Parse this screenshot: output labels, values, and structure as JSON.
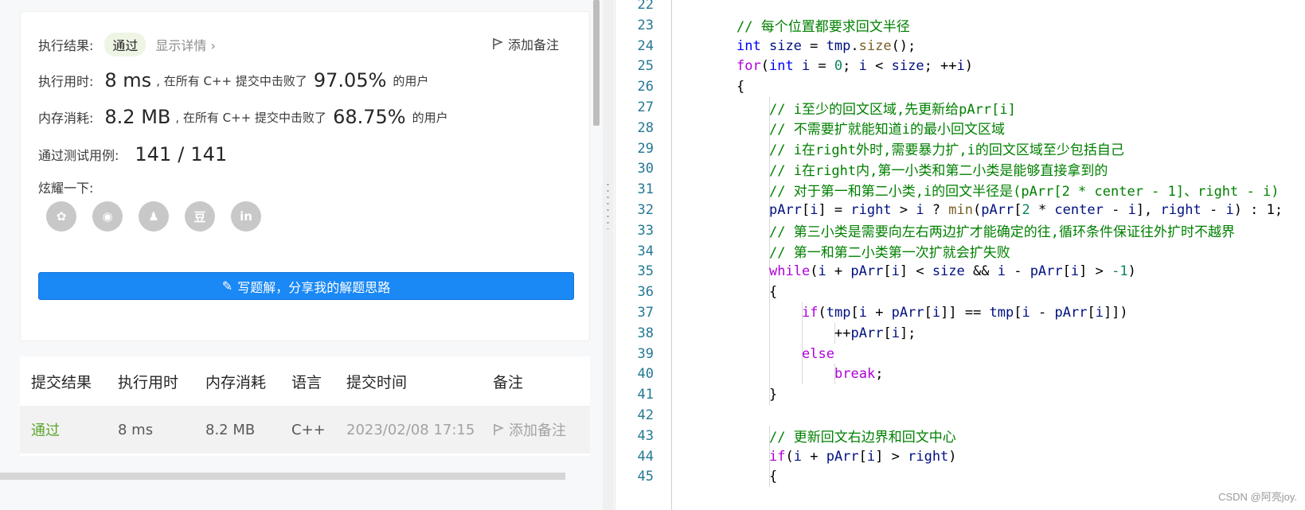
{
  "result": {
    "label": "执行结果:",
    "status": "通过",
    "details_link": "显示详情 ›",
    "add_note": "添加备注"
  },
  "runtime": {
    "label": "执行用时:",
    "value": "8 ms",
    "mid_text": ", 在所有 C++ 提交中击败了",
    "percent": "97.05%",
    "suffix": "的用户"
  },
  "memory": {
    "label": "内存消耗:",
    "value": "8.2 MB",
    "mid_text": ", 在所有 C++ 提交中击败了",
    "percent": "68.75%",
    "suffix": "的用户"
  },
  "testcases": {
    "label": "通过测试用例:",
    "passed": "141",
    "sep": "/",
    "total": "141"
  },
  "share": {
    "label": "炫耀一下:",
    "icons": [
      "wechat-icon",
      "weibo-icon",
      "qq-icon",
      "douban-icon",
      "linkedin-icon"
    ],
    "glyphs": [
      "✿",
      "◉",
      "♟",
      "豆",
      "in"
    ]
  },
  "write_button": "写题解，分享我的解题思路",
  "submissions": {
    "headers": [
      "提交结果",
      "执行用时",
      "内存消耗",
      "语言",
      "提交时间",
      "备注"
    ],
    "rows": [
      {
        "result": "通过",
        "runtime": "8 ms",
        "memory": "8.2 MB",
        "lang": "C++",
        "time": "2023/02/08 17:15",
        "note": "添加备注"
      }
    ]
  },
  "code": {
    "lines": [
      {
        "n": "22",
        "indent": 0,
        "tokens": []
      },
      {
        "n": "23",
        "indent": 1,
        "tokens": [
          [
            "cm",
            "// 每个位置都要求回文半径"
          ]
        ]
      },
      {
        "n": "24",
        "indent": 1,
        "tokens": [
          [
            "ty",
            "int"
          ],
          [
            "op",
            " "
          ],
          [
            "id",
            "size"
          ],
          [
            "op",
            " = "
          ],
          [
            "id",
            "tmp"
          ],
          [
            "op",
            "."
          ],
          [
            "fn",
            "size"
          ],
          [
            "op",
            "();"
          ]
        ]
      },
      {
        "n": "25",
        "indent": 1,
        "tokens": [
          [
            "kw",
            "for"
          ],
          [
            "op",
            "("
          ],
          [
            "ty",
            "int"
          ],
          [
            "op",
            " "
          ],
          [
            "id",
            "i"
          ],
          [
            "op",
            " = "
          ],
          [
            "num",
            "0"
          ],
          [
            "op",
            "; "
          ],
          [
            "id",
            "i"
          ],
          [
            "op",
            " < "
          ],
          [
            "id",
            "size"
          ],
          [
            "op",
            "; ++"
          ],
          [
            "id",
            "i"
          ],
          [
            "op",
            ")"
          ]
        ]
      },
      {
        "n": "26",
        "indent": 1,
        "tokens": [
          [
            "op",
            "{"
          ]
        ]
      },
      {
        "n": "27",
        "indent": 2,
        "tokens": [
          [
            "cm",
            "// i至少的回文区域,先更新给pArr[i]"
          ]
        ]
      },
      {
        "n": "28",
        "indent": 2,
        "tokens": [
          [
            "cm",
            "// 不需要扩就能知道i的最小回文区域"
          ]
        ]
      },
      {
        "n": "29",
        "indent": 2,
        "tokens": [
          [
            "cm",
            "// i在right外时,需要暴力扩,i的回文区域至少包括自己"
          ]
        ]
      },
      {
        "n": "30",
        "indent": 2,
        "tokens": [
          [
            "cm",
            "// i在right内,第一小类和第二小类是能够直接拿到的"
          ]
        ]
      },
      {
        "n": "31",
        "indent": 2,
        "tokens": [
          [
            "cm",
            "// 对于第一和第二小类,i的回文半径是(pArr[2 * center - 1]、right - i)"
          ]
        ]
      },
      {
        "n": "32",
        "indent": 2,
        "tokens": [
          [
            "id",
            "pArr"
          ],
          [
            "op",
            "["
          ],
          [
            "id",
            "i"
          ],
          [
            "op",
            "] = "
          ],
          [
            "id",
            "right"
          ],
          [
            "op",
            " > "
          ],
          [
            "id",
            "i"
          ],
          [
            "op",
            " ? "
          ],
          [
            "fn",
            "min"
          ],
          [
            "op",
            "("
          ],
          [
            "id",
            "pArr"
          ],
          [
            "op",
            "["
          ],
          [
            "num",
            "2"
          ],
          [
            "op",
            " * "
          ],
          [
            "id",
            "center"
          ],
          [
            "op",
            " - "
          ],
          [
            "id",
            "i"
          ],
          [
            "op",
            "], "
          ],
          [
            "id",
            "right"
          ],
          [
            "op",
            " - "
          ],
          [
            "id",
            "i"
          ],
          [
            "op",
            ") : 1;"
          ]
        ]
      },
      {
        "n": "33",
        "indent": 2,
        "tokens": [
          [
            "cm",
            "// 第三小类是需要向左右两边扩才能确定的往,循环条件保证往外扩时不越界"
          ]
        ]
      },
      {
        "n": "34",
        "indent": 2,
        "tokens": [
          [
            "cm",
            "// 第一和第二小类第一次扩就会扩失败"
          ]
        ]
      },
      {
        "n": "35",
        "indent": 2,
        "tokens": [
          [
            "kw",
            "while"
          ],
          [
            "op",
            "("
          ],
          [
            "id",
            "i"
          ],
          [
            "op",
            " + "
          ],
          [
            "id",
            "pArr"
          ],
          [
            "op",
            "["
          ],
          [
            "id",
            "i"
          ],
          [
            "op",
            "] < "
          ],
          [
            "id",
            "size"
          ],
          [
            "op",
            " && "
          ],
          [
            "id",
            "i"
          ],
          [
            "op",
            " - "
          ],
          [
            "id",
            "pArr"
          ],
          [
            "op",
            "["
          ],
          [
            "id",
            "i"
          ],
          [
            "op",
            "] > "
          ],
          [
            "num",
            "-1"
          ],
          [
            "op",
            ")"
          ]
        ]
      },
      {
        "n": "36",
        "indent": 2,
        "tokens": [
          [
            "op",
            "{"
          ]
        ]
      },
      {
        "n": "37",
        "indent": 3,
        "tokens": [
          [
            "kw",
            "if"
          ],
          [
            "op",
            "("
          ],
          [
            "id",
            "tmp"
          ],
          [
            "op",
            "["
          ],
          [
            "id",
            "i"
          ],
          [
            "op",
            " + "
          ],
          [
            "id",
            "pArr"
          ],
          [
            "op",
            "["
          ],
          [
            "id",
            "i"
          ],
          [
            "op",
            "]] == "
          ],
          [
            "id",
            "tmp"
          ],
          [
            "op",
            "["
          ],
          [
            "id",
            "i"
          ],
          [
            "op",
            " - "
          ],
          [
            "id",
            "pArr"
          ],
          [
            "op",
            "["
          ],
          [
            "id",
            "i"
          ],
          [
            "op",
            "]])"
          ]
        ]
      },
      {
        "n": "38",
        "indent": 4,
        "tokens": [
          [
            "op",
            "++"
          ],
          [
            "id",
            "pArr"
          ],
          [
            "op",
            "["
          ],
          [
            "id",
            "i"
          ],
          [
            "op",
            "];"
          ]
        ]
      },
      {
        "n": "39",
        "indent": 3,
        "tokens": [
          [
            "kw",
            "else"
          ]
        ]
      },
      {
        "n": "40",
        "indent": 4,
        "tokens": [
          [
            "kw",
            "break"
          ],
          [
            "op",
            ";"
          ]
        ]
      },
      {
        "n": "41",
        "indent": 2,
        "tokens": [
          [
            "op",
            "}"
          ]
        ]
      },
      {
        "n": "42",
        "indent": 0,
        "tokens": []
      },
      {
        "n": "43",
        "indent": 2,
        "tokens": [
          [
            "cm",
            "// 更新回文右边界和回文中心"
          ]
        ]
      },
      {
        "n": "44",
        "indent": 2,
        "tokens": [
          [
            "kw",
            "if"
          ],
          [
            "op",
            "("
          ],
          [
            "id",
            "i"
          ],
          [
            "op",
            " + "
          ],
          [
            "id",
            "pArr"
          ],
          [
            "op",
            "["
          ],
          [
            "id",
            "i"
          ],
          [
            "op",
            "] > "
          ],
          [
            "id",
            "right"
          ],
          [
            "op",
            ")"
          ]
        ]
      },
      {
        "n": "45",
        "indent": 2,
        "tokens": [
          [
            "op",
            "{"
          ]
        ]
      }
    ]
  },
  "watermark": "CSDN @阿亮joy."
}
